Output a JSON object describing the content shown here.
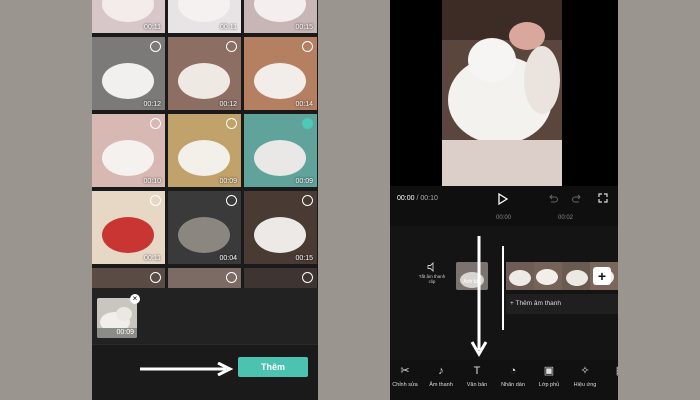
{
  "left_screen": {
    "media_grid": [
      {
        "duration": "00:11",
        "selected": false
      },
      {
        "duration": "00:11",
        "selected": false
      },
      {
        "duration": "00:15",
        "selected": false
      },
      {
        "duration": "00:12",
        "selected": false
      },
      {
        "duration": "00:12",
        "selected": false
      },
      {
        "duration": "00:14",
        "selected": false
      },
      {
        "duration": "00:10",
        "selected": false
      },
      {
        "duration": "00:09",
        "selected": false
      },
      {
        "duration": "00:09",
        "selected": true
      },
      {
        "duration": "00:11",
        "selected": false
      },
      {
        "duration": "00:04",
        "selected": false
      },
      {
        "duration": "00:15",
        "selected": false
      },
      {
        "duration": "",
        "selected": false
      },
      {
        "duration": "",
        "selected": false
      },
      {
        "duration": "",
        "selected": false
      }
    ],
    "tray": {
      "duration": "00:09",
      "close_symbol": "×"
    },
    "add_button_label": "Thêm",
    "accent_color": "#4cc2b0"
  },
  "right_screen": {
    "time_current": "00:00",
    "time_separator": " / ",
    "time_total": "00:10",
    "ruler_labels": [
      "00:00",
      "00:02"
    ],
    "mute_label": "Tắt âm thanh clip",
    "cover_label": "Ảnh bìa",
    "add_audio_label": "+ Thêm âm thanh",
    "toolbar": [
      {
        "icon": "scissors-icon",
        "label": "Chỉnh sửa"
      },
      {
        "icon": "music-note-icon",
        "label": "Âm thanh"
      },
      {
        "icon": "text-icon",
        "label": "Văn bản"
      },
      {
        "icon": "sticker-icon",
        "label": "Nhãn dán"
      },
      {
        "icon": "overlay-icon",
        "label": "Lớp phủ"
      },
      {
        "icon": "effects-icon",
        "label": "Hiệu ứng"
      },
      {
        "icon": "more-icon",
        "label": "B"
      }
    ]
  }
}
